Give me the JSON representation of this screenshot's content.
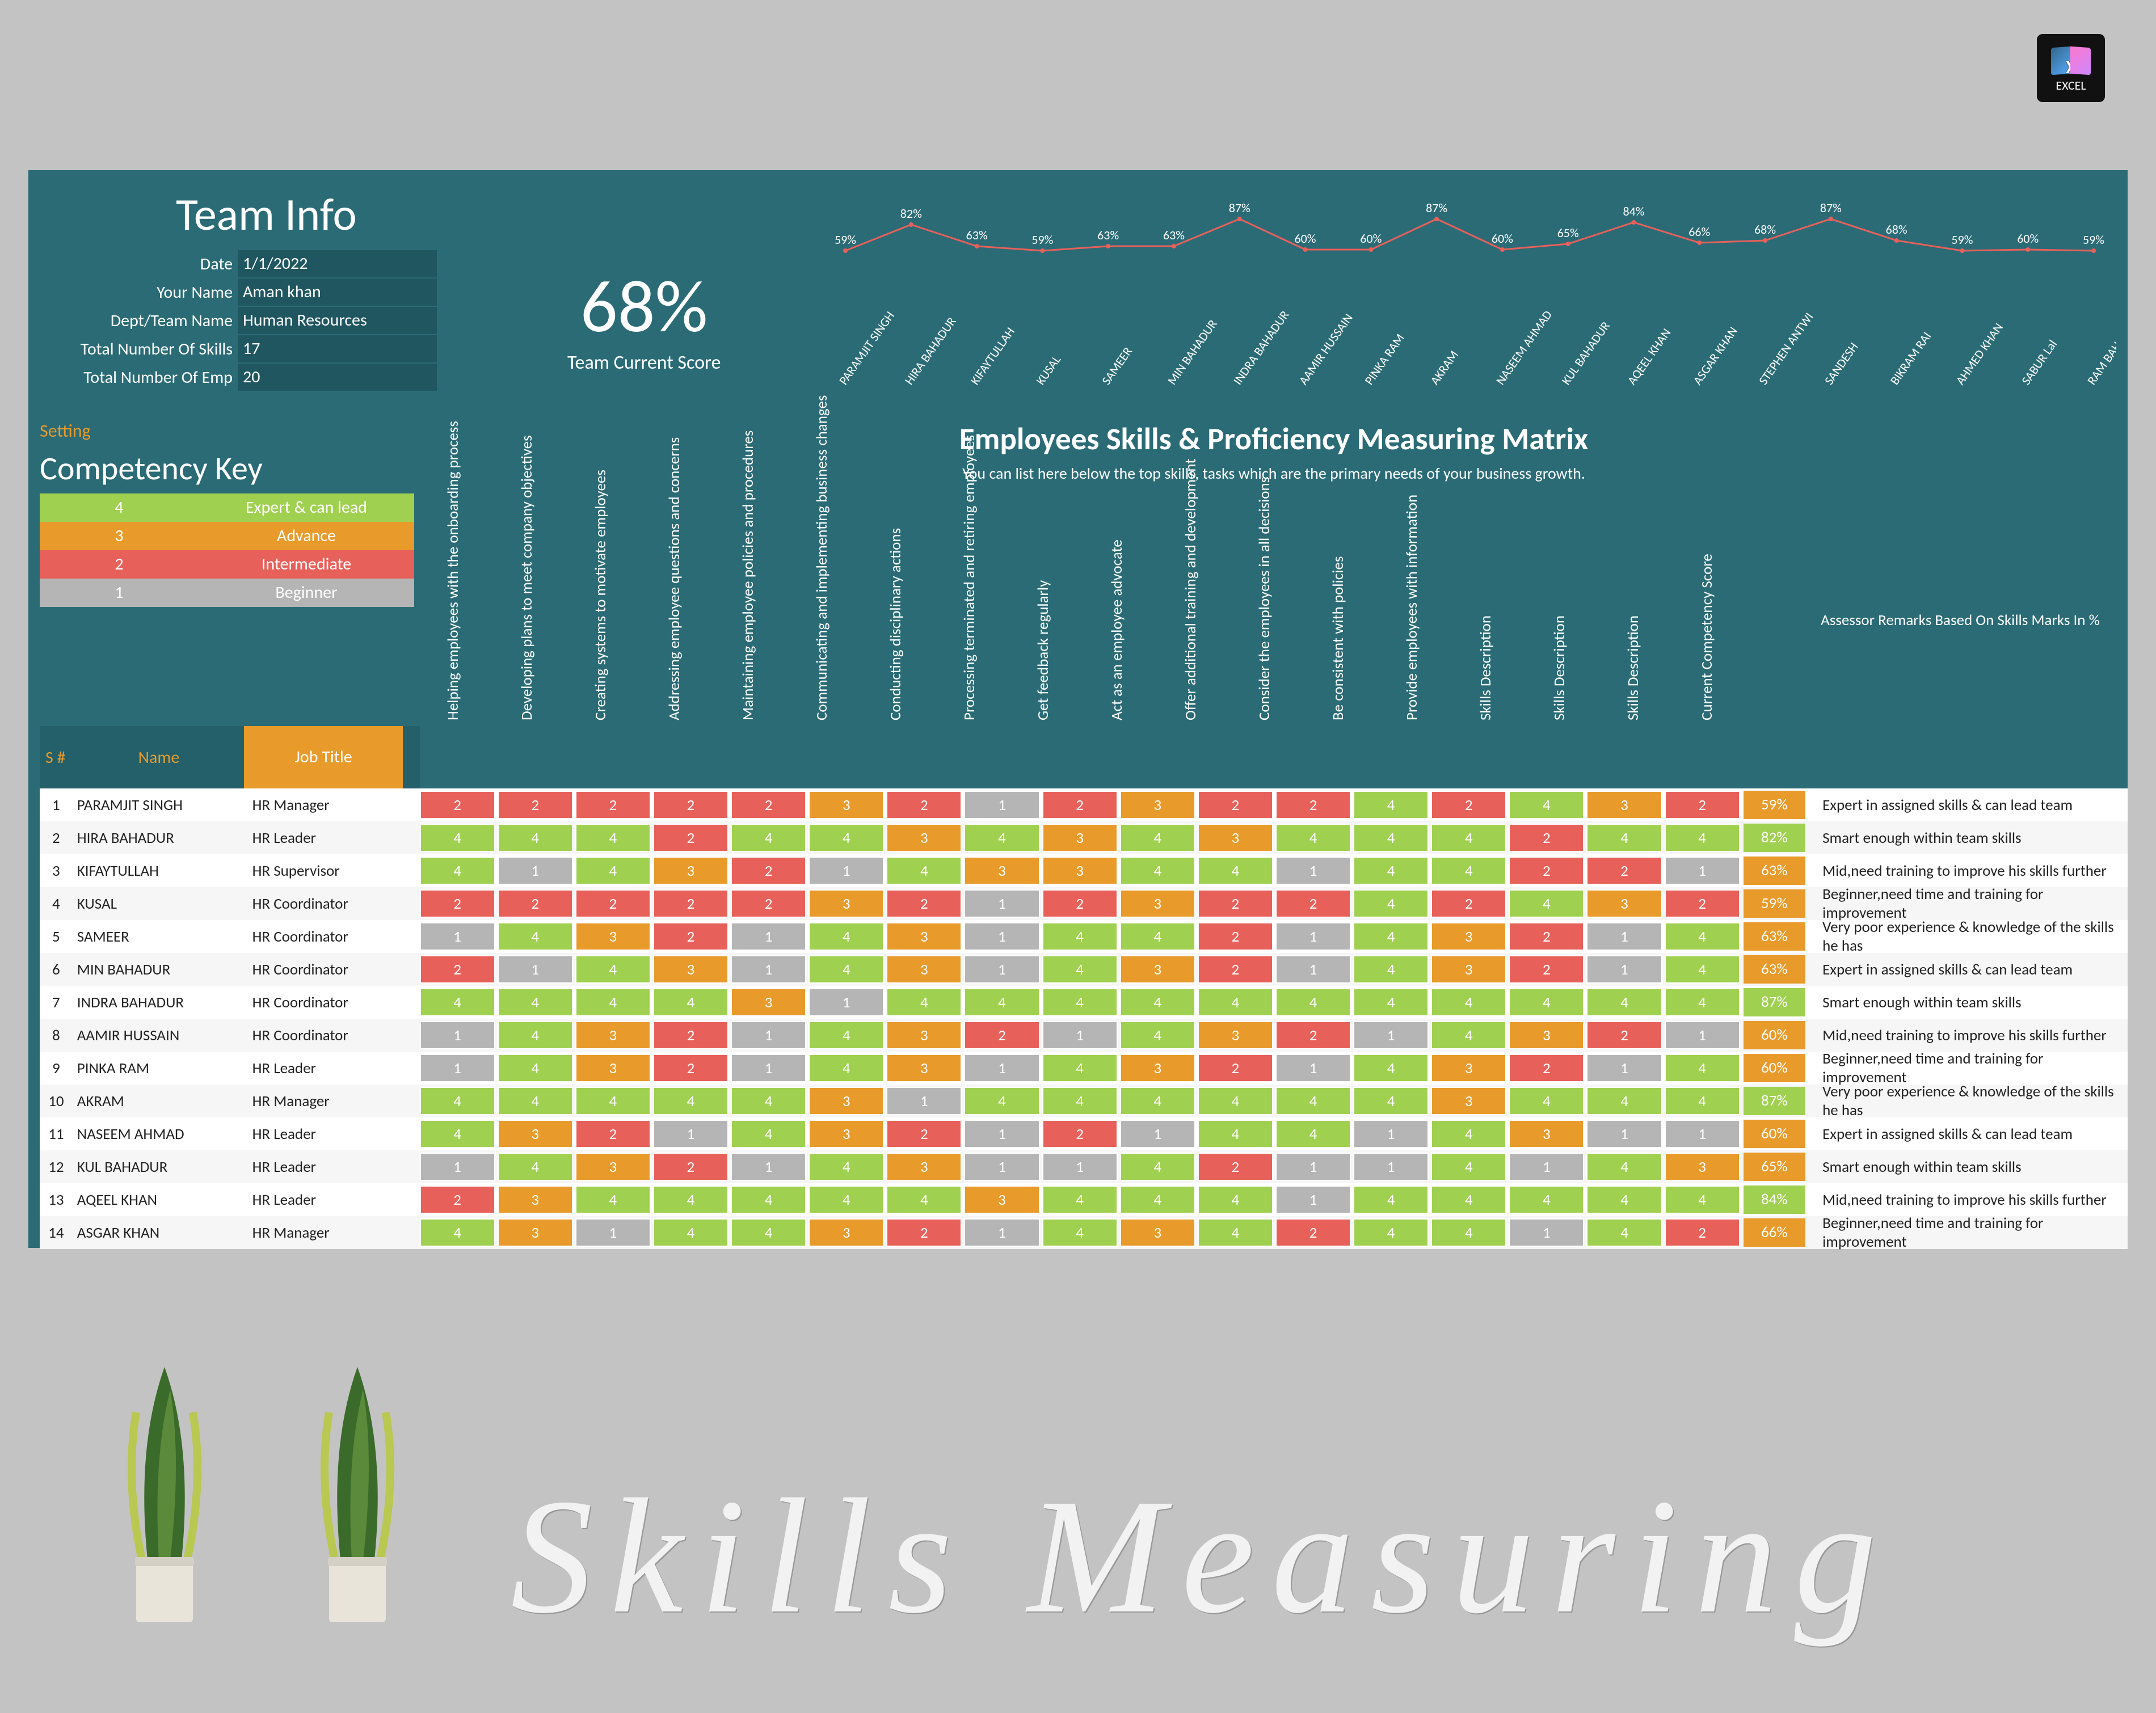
{
  "excel_label": "EXCEL",
  "team_title": "Team Info",
  "team_info": {
    "date_label": "Date",
    "date": "1/1/2022",
    "name_label": "Your Name",
    "name": "Aman khan",
    "dept_label": "Dept/Team Name",
    "dept": "Human Resources",
    "skills_label": "Total Number Of Skills",
    "skills": "17",
    "emp_label": "Total Number Of Emp",
    "emp": "20"
  },
  "big_score": {
    "pct": "68%",
    "label": "Team Current Score"
  },
  "setting": "Setting",
  "comp_title": "Competency Key",
  "comp_key": [
    {
      "n": "4",
      "t": "Expert & can lead",
      "cls": "c4"
    },
    {
      "n": "3",
      "t": "Advance",
      "cls": "c3"
    },
    {
      "n": "2",
      "t": "Intermediate",
      "cls": "c2"
    },
    {
      "n": "1",
      "t": "Beginner",
      "cls": "c1"
    }
  ],
  "matrix_title": "Employees Skills & Proficiency Measuring Matrix",
  "matrix_sub": "You can list here below the top skills, tasks which are the primary needs of your business growth.",
  "skill_heads": [
    "Helping employees with the onboarding process",
    "Developing plans to meet company objectives",
    "Creating systems to motivate employees",
    "Addressing employee questions and concerns",
    "Maintaining employee policies and procedures",
    "Communicating and implementing business changes",
    "Conducting disciplinary actions",
    "Processing terminated and retiring employees",
    "Get feedback regularly",
    "Act as an employee advocate",
    "Offer additional training and development",
    "Consider the employees in all decisions",
    "Be consistent with policies",
    "Provide employees with information",
    "Skills Description",
    "Skills Description",
    "Skills Description",
    "Current Competency Score"
  ],
  "assessor_head": "Assessor Remarks Based On Skills Marks In %",
  "header_labels": {
    "sn": "S #",
    "name": "Name",
    "job": "Job Title"
  },
  "chart_data": {
    "type": "line",
    "categories": [
      "PARAMJIT SINGH",
      "HIRA BAHADUR",
      "KIFAYTULLAH",
      "KUSAL",
      "SAMEER",
      "MIN BAHADUR",
      "INDRA BAHADUR",
      "AAMIR HUSSAIN",
      "PINKA RAM",
      "AKRAM",
      "NASEEM AHMAD",
      "KUL BAHADUR",
      "AQEEL KHAN",
      "ASGAR KHAN",
      "STEPHEN ANTWI",
      "SANDESH",
      "BIKRAM RAI",
      "AHMED KHAN",
      "SABUR Lal",
      "RAM BAHADUR"
    ],
    "values": [
      59,
      82,
      63,
      59,
      63,
      63,
      87,
      60,
      60,
      87,
      60,
      65,
      84,
      66,
      68,
      87,
      68,
      59,
      60,
      59
    ],
    "ylim": [
      50,
      100
    ]
  },
  "rows": [
    {
      "n": "1",
      "name": "PARAMJIT SINGH",
      "job": "HR Manager",
      "c": [
        2,
        2,
        2,
        2,
        2,
        3,
        2,
        1,
        2,
        3,
        2,
        2,
        4,
        2,
        4,
        3,
        2
      ],
      "s": "59%",
      "sc": "c3",
      "r": "Expert in assigned skills & can lead team"
    },
    {
      "n": "2",
      "name": "HIRA BAHADUR",
      "job": "HR Leader",
      "c": [
        4,
        4,
        4,
        2,
        4,
        4,
        3,
        4,
        3,
        4,
        3,
        4,
        4,
        4,
        2,
        4,
        4
      ],
      "s": "82%",
      "sc": "c4",
      "r": "Smart enough within team skills"
    },
    {
      "n": "3",
      "name": "KIFAYTULLAH",
      "job": "HR Supervisor",
      "c": [
        4,
        1,
        4,
        3,
        2,
        1,
        4,
        3,
        3,
        4,
        4,
        1,
        4,
        4,
        2,
        2,
        1
      ],
      "s": "63%",
      "sc": "c3",
      "r": "Mid,need training to improve his skills further"
    },
    {
      "n": "4",
      "name": "KUSAL",
      "job": "HR Coordinator",
      "c": [
        2,
        2,
        2,
        2,
        2,
        3,
        2,
        1,
        2,
        3,
        2,
        2,
        4,
        2,
        4,
        3,
        2
      ],
      "s": "59%",
      "sc": "c3",
      "r": "Beginner,need time and training for improvement"
    },
    {
      "n": "5",
      "name": "SAMEER",
      "job": "HR Coordinator",
      "c": [
        1,
        4,
        3,
        2,
        1,
        4,
        3,
        1,
        4,
        4,
        2,
        1,
        4,
        3,
        2,
        1,
        4
      ],
      "s": "63%",
      "sc": "c3",
      "r": "Very poor experience & knowledge of the skills he has"
    },
    {
      "n": "6",
      "name": "MIN BAHADUR",
      "job": "HR Coordinator",
      "c": [
        2,
        1,
        4,
        3,
        1,
        4,
        3,
        1,
        4,
        3,
        2,
        1,
        4,
        3,
        2,
        1,
        4
      ],
      "s": "63%",
      "sc": "c3",
      "r": "Expert in assigned skills & can lead team"
    },
    {
      "n": "7",
      "name": "INDRA BAHADUR",
      "job": "HR Coordinator",
      "c": [
        4,
        4,
        4,
        4,
        3,
        1,
        4,
        4,
        4,
        4,
        4,
        4,
        4,
        4,
        4,
        4,
        4
      ],
      "s": "87%",
      "sc": "c4",
      "r": "Smart enough within team skills"
    },
    {
      "n": "8",
      "name": "AAMIR HUSSAIN",
      "job": "HR Coordinator",
      "c": [
        1,
        4,
        3,
        2,
        1,
        4,
        3,
        2,
        1,
        4,
        3,
        2,
        1,
        4,
        3,
        2,
        1
      ],
      "s": "60%",
      "sc": "c3",
      "r": "Mid,need training to improve his skills further"
    },
    {
      "n": "9",
      "name": "PINKA RAM",
      "job": "HR Leader",
      "c": [
        1,
        4,
        3,
        2,
        1,
        4,
        3,
        1,
        4,
        3,
        2,
        1,
        4,
        3,
        2,
        1,
        4
      ],
      "s": "60%",
      "sc": "c3",
      "r": "Beginner,need time and training for improvement"
    },
    {
      "n": "10",
      "name": "AKRAM",
      "job": "HR Manager",
      "c": [
        4,
        4,
        4,
        4,
        4,
        3,
        1,
        4,
        4,
        4,
        4,
        4,
        4,
        3,
        4,
        4,
        4
      ],
      "s": "87%",
      "sc": "c4",
      "r": "Very poor experience & knowledge of the skills he has"
    },
    {
      "n": "11",
      "name": "NASEEM AHMAD",
      "job": "HR Leader",
      "c": [
        4,
        3,
        2,
        1,
        4,
        3,
        2,
        1,
        2,
        1,
        4,
        4,
        1,
        4,
        3,
        1,
        1
      ],
      "s": "60%",
      "sc": "c3",
      "r": "Expert in assigned skills & can lead team"
    },
    {
      "n": "12",
      "name": "KUL BAHADUR",
      "job": "HR Leader",
      "c": [
        1,
        4,
        3,
        2,
        1,
        4,
        3,
        1,
        1,
        4,
        2,
        1,
        1,
        4,
        1,
        4,
        3
      ],
      "s": "65%",
      "sc": "c3",
      "r": "Smart enough within team skills"
    },
    {
      "n": "13",
      "name": "AQEEL KHAN",
      "job": "HR Leader",
      "c": [
        2,
        3,
        4,
        4,
        4,
        4,
        4,
        3,
        4,
        4,
        4,
        1,
        4,
        4,
        4,
        4,
        4
      ],
      "s": "84%",
      "sc": "c4",
      "r": "Mid,need training to improve his skills further"
    },
    {
      "n": "14",
      "name": "ASGAR KHAN",
      "job": "HR Manager",
      "c": [
        4,
        3,
        1,
        4,
        4,
        3,
        2,
        1,
        4,
        3,
        4,
        2,
        4,
        4,
        1,
        4,
        2
      ],
      "s": "66%",
      "sc": "c3",
      "r": "Beginner,need time and training for improvement"
    }
  ],
  "script_text": "Skills  Measuring"
}
